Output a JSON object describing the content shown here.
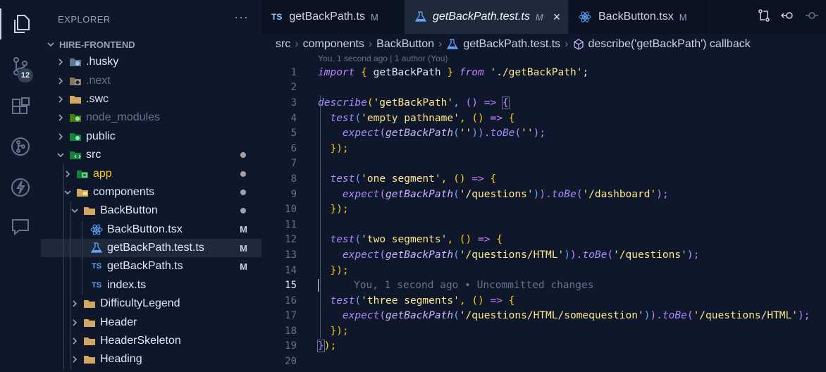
{
  "activity": {
    "scm_badge": "12"
  },
  "sidebar": {
    "title": "EXPLORER",
    "more": "···",
    "root": "HIRE-FRONTEND",
    "items": [
      {
        "label": ".husky",
        "git": ""
      },
      {
        "label": ".next",
        "git": ""
      },
      {
        "label": ".swc",
        "git": ""
      },
      {
        "label": "node_modules",
        "git": ""
      },
      {
        "label": "public",
        "git": ""
      },
      {
        "label": "src",
        "git": ""
      },
      {
        "label": "app",
        "git": ""
      },
      {
        "label": "components",
        "git": ""
      },
      {
        "label": "BackButton",
        "git": ""
      },
      {
        "label": "BackButton.tsx",
        "git": "M"
      },
      {
        "label": "getBackPath.test.ts",
        "git": "M"
      },
      {
        "label": "getBackPath.ts",
        "git": "M"
      },
      {
        "label": "index.ts",
        "git": ""
      },
      {
        "label": "DifficultyLegend",
        "git": ""
      },
      {
        "label": "Header",
        "git": ""
      },
      {
        "label": "HeaderSkeleton",
        "git": ""
      },
      {
        "label": "Heading",
        "git": ""
      }
    ]
  },
  "tabs": [
    {
      "icon": "TS",
      "label": "getBackPath.ts",
      "mark": "M"
    },
    {
      "label": "getBackPath.test.ts",
      "mark": "M",
      "close": "×"
    },
    {
      "label": "BackButton.tsx",
      "mark": "M"
    }
  ],
  "breadcrumb": [
    "src",
    "components",
    "BackButton",
    "getBackPath.test.ts",
    "describe('getBackPath') callback"
  ],
  "breadcrumb_sep": "›",
  "blame_header": "You, 1 second ago | 1 author (You)",
  "ts_icon_text": "TS",
  "code": {
    "line_numbers": [
      "1",
      "2",
      "3",
      "4",
      "5",
      "6",
      "7",
      "8",
      "9",
      "10",
      "11",
      "12",
      "13",
      "14",
      "15",
      "16",
      "17",
      "18",
      "19",
      "20"
    ],
    "l1": {
      "a": "import",
      "b": " { ",
      "c": "getBackPath",
      "d": " } ",
      "e": "from",
      "f": " './getBackPath'",
      "g": ";"
    },
    "l3": {
      "a": "describe",
      "b": "(",
      "c": "'getBackPath'",
      "d": ", () ",
      "e": "=>",
      "f": " ",
      "g": "{"
    },
    "l4": {
      "a": "test",
      "b": "(",
      "c": "'empty pathname'",
      "d": ", () ",
      "e": "=>",
      "f": " {"
    },
    "l5": {
      "a": "expect",
      "b": "(",
      "c": "getBackPath",
      "d": "(",
      "e": "''",
      "f": ")",
      "g": ").",
      "h": "toBe",
      "i": "(",
      "j": "''",
      "k": ");"
    },
    "l6": {
      "a": "});"
    },
    "l8": {
      "a": "test",
      "b": "(",
      "c": "'one segment'",
      "d": ", () ",
      "e": "=>",
      "f": " {"
    },
    "l9": {
      "a": "expect",
      "b": "(",
      "c": "getBackPath",
      "d": "(",
      "e": "'/questions'",
      "f": ")",
      "g": ").",
      "h": "toBe",
      "i": "(",
      "j": "'/dashboard'",
      "k": ");"
    },
    "l10": {
      "a": "});"
    },
    "l12": {
      "a": "test",
      "b": "(",
      "c": "'two segments'",
      "d": ", () ",
      "e": "=>",
      "f": " {"
    },
    "l13": {
      "a": "expect",
      "b": "(",
      "c": "getBackPath",
      "d": "(",
      "e": "'/questions/HTML'",
      "f": ")",
      "g": ").",
      "h": "toBe",
      "i": "(",
      "j": "'/questions'",
      "k": ");"
    },
    "l14": {
      "a": "});"
    },
    "l15": {
      "a": "You, 1 second ago • Uncommitted changes"
    },
    "l16": {
      "a": "test",
      "b": "(",
      "c": "'three segments'",
      "d": ", () ",
      "e": "=>",
      "f": " {"
    },
    "l17": {
      "a": "expect",
      "b": "(",
      "c": "getBackPath",
      "d": "(",
      "e": "'/questions/HTML/somequestion'",
      "f": ")",
      "g": ").",
      "h": "toBe",
      "i": "(",
      "j": "'/questions/HTML'",
      "k": ");"
    },
    "l18": {
      "a": "});"
    },
    "l19": {
      "a": "}",
      "b": ");"
    }
  },
  "colors": {
    "background": "#0f172a",
    "selection": "#1e293b",
    "accent": "#a78bfa",
    "string": "#fde68a"
  }
}
